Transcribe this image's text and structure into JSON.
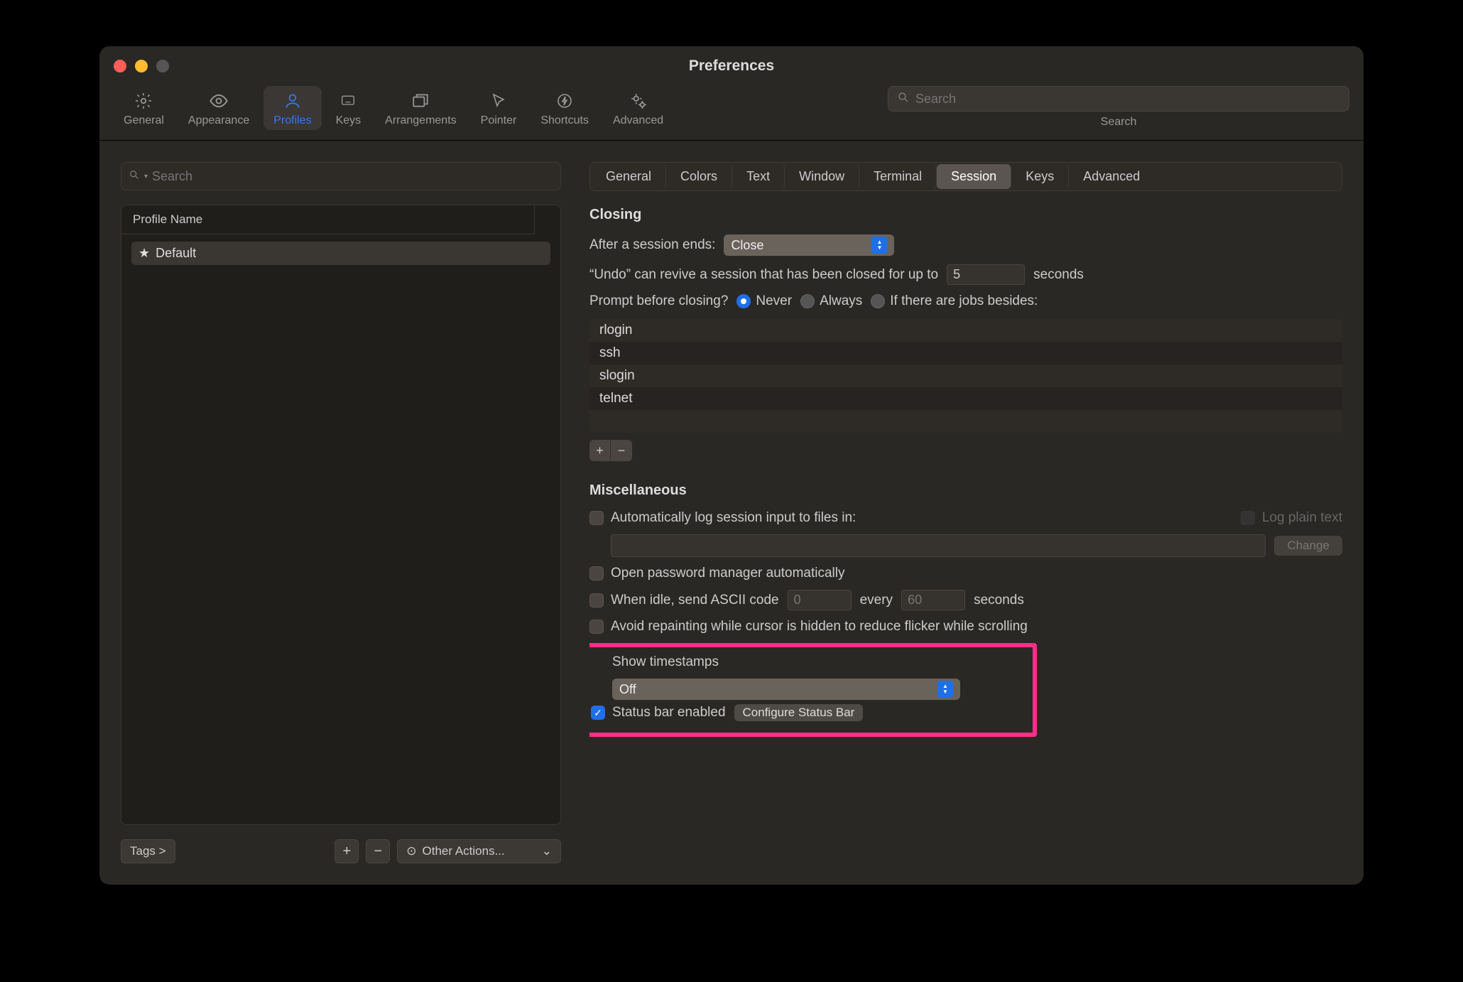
{
  "window": {
    "title": "Preferences"
  },
  "toolbar": {
    "items": [
      {
        "label": "General"
      },
      {
        "label": "Appearance"
      },
      {
        "label": "Profiles"
      },
      {
        "label": "Keys"
      },
      {
        "label": "Arrangements"
      },
      {
        "label": "Pointer"
      },
      {
        "label": "Shortcuts"
      },
      {
        "label": "Advanced"
      }
    ],
    "search_placeholder": "Search",
    "search_label": "Search"
  },
  "sidebar": {
    "search_placeholder": "Search",
    "header": "Profile Name",
    "profiles": [
      "Default"
    ],
    "tags_label": "Tags >",
    "other_actions_label": "Other Actions..."
  },
  "tabs": [
    "General",
    "Colors",
    "Text",
    "Window",
    "Terminal",
    "Session",
    "Keys",
    "Advanced"
  ],
  "active_tab": "Session",
  "closing": {
    "title": "Closing",
    "after_ends_label": "After a session ends:",
    "after_ends_value": "Close",
    "undo_prefix": "“Undo” can revive a session that has been closed for up to",
    "undo_value": "5",
    "undo_suffix": "seconds",
    "prompt_label": "Prompt before closing?",
    "prompt_options": [
      "Never",
      "Always",
      "If there are jobs besides:"
    ],
    "prompt_selected": "Never",
    "jobs": [
      "rlogin",
      "ssh",
      "slogin",
      "telnet"
    ]
  },
  "misc": {
    "title": "Miscellaneous",
    "auto_log_label": "Automatically log session input to files in:",
    "log_plain_label": "Log plain text",
    "change_label": "Change",
    "pwmgr_label": "Open password manager automatically",
    "idle_prefix": "When idle, send ASCII code",
    "idle_code": "0",
    "idle_mid": "every",
    "idle_seconds": "60",
    "idle_suffix": "seconds",
    "avoid_repaint_label": "Avoid repainting while cursor is hidden to reduce flicker while scrolling",
    "timestamps_label": "Show timestamps",
    "timestamps_value": "Off",
    "status_bar_label": "Status bar enabled",
    "status_bar_checked": true,
    "configure_label": "Configure Status Bar"
  }
}
